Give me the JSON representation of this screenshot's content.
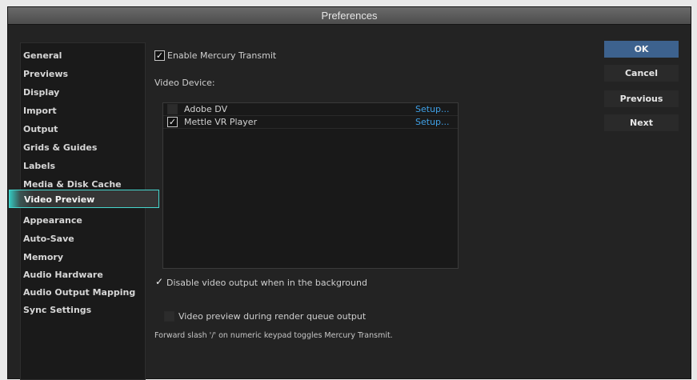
{
  "window": {
    "title": "Preferences"
  },
  "sidebar": {
    "items": [
      {
        "label": "General"
      },
      {
        "label": "Previews"
      },
      {
        "label": "Display"
      },
      {
        "label": "Import"
      },
      {
        "label": "Output"
      },
      {
        "label": "Grids & Guides"
      },
      {
        "label": "Labels"
      },
      {
        "label": "Media & Disk Cache"
      },
      {
        "label": "Video Preview",
        "selected": true
      },
      {
        "label": "Appearance"
      },
      {
        "label": "Auto-Save"
      },
      {
        "label": "Memory"
      },
      {
        "label": "Audio Hardware"
      },
      {
        "label": "Audio Output Mapping"
      },
      {
        "label": "Sync Settings"
      }
    ]
  },
  "main": {
    "enable_transmit": {
      "label": "Enable Mercury Transmit",
      "checked": true
    },
    "video_device_label": "Video Device:",
    "devices": [
      {
        "name": "Adobe DV",
        "checked": false,
        "setup": "Setup..."
      },
      {
        "name": "Mettle VR Player",
        "checked": true,
        "setup": "Setup..."
      }
    ],
    "disable_background": {
      "label": "Disable video output when in the background",
      "checked": true
    },
    "render_queue_preview": {
      "label": "Video preview during render queue output",
      "checked": false
    },
    "note": "Forward slash '/' on numeric keypad toggles Mercury Transmit."
  },
  "buttons": {
    "ok": "OK",
    "cancel": "Cancel",
    "previous": "Previous",
    "next": "Next"
  },
  "colors": {
    "accent_teal": "#34c6bf",
    "ok_blue": "#3d628e",
    "link_blue": "#3fa0e6"
  },
  "glyphs": {
    "check": "✓"
  }
}
